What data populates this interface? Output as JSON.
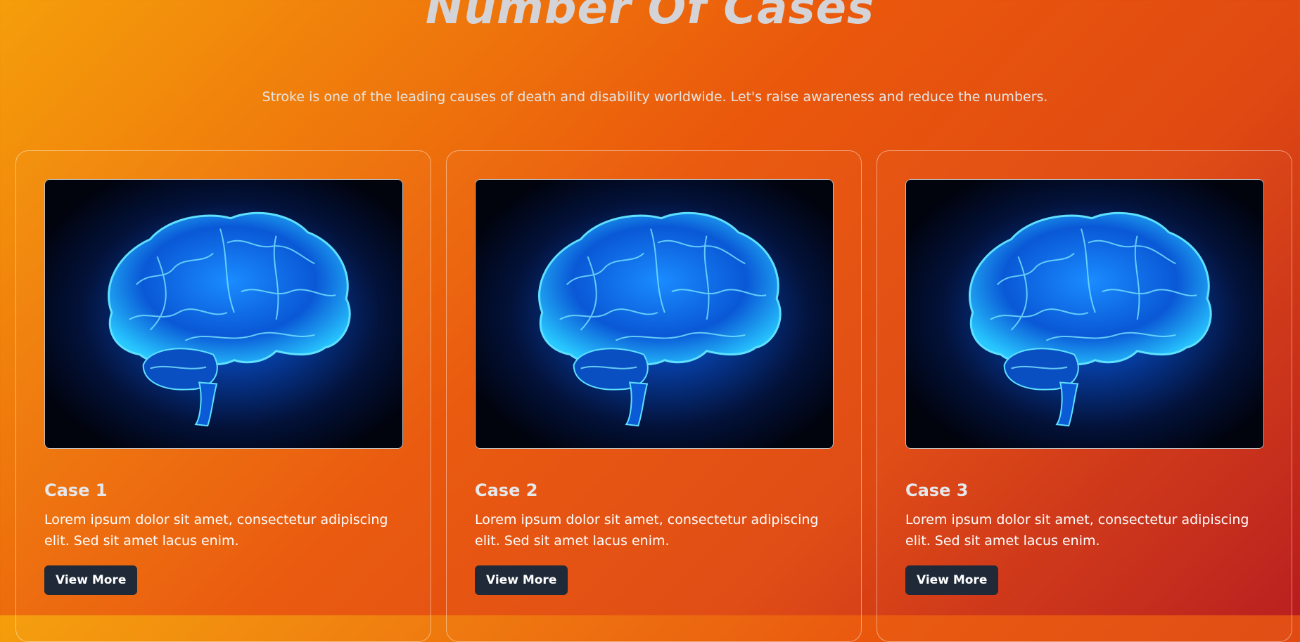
{
  "header": {
    "title": "Number Of Cases",
    "subtitle": "Stroke is one of the leading causes of death and disability worldwide. Let's raise awareness and reduce the numbers."
  },
  "cards": [
    {
      "image_icon": "brain-icon",
      "title": "Case 1",
      "text": "Lorem ipsum dolor sit amet, consectetur adipiscing elit. Sed sit amet lacus enim.",
      "button_label": "View More"
    },
    {
      "image_icon": "brain-icon",
      "title": "Case 2",
      "text": "Lorem ipsum dolor sit amet, consectetur adipiscing elit. Sed sit amet lacus enim.",
      "button_label": "View More"
    },
    {
      "image_icon": "brain-icon",
      "title": "Case 3",
      "text": "Lorem ipsum dolor sit amet, consectetur adipiscing elit. Sed sit amet lacus enim.",
      "button_label": "View More"
    }
  ],
  "colors": {
    "background_start": "#f59e0b",
    "background_end": "#b91c1c",
    "button": "#1f2937",
    "title_text": "#d4d4d8",
    "brain_glow": "#0ea5ff"
  }
}
